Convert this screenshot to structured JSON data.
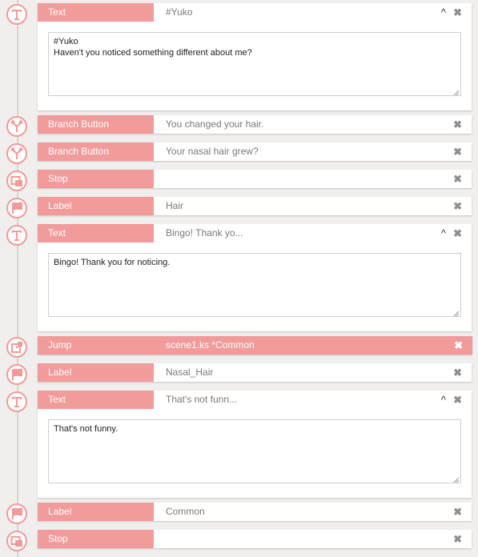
{
  "commands": [
    {
      "type": "Text",
      "summary": "#Yuko",
      "content": "#Yuko\nHaven't you noticed something different about me?",
      "expanded": true,
      "active": false,
      "icon": "text-icon"
    },
    {
      "type": "Branch Button",
      "summary": "You changed your hair.",
      "expanded": false,
      "active": false,
      "icon": "branch-icon"
    },
    {
      "type": "Branch Button",
      "summary": "Your nasal hair grew?",
      "expanded": false,
      "active": false,
      "icon": "branch-icon"
    },
    {
      "type": "Stop",
      "summary": "",
      "expanded": false,
      "active": false,
      "icon": "stop-icon"
    },
    {
      "type": "Label",
      "summary": "Hair",
      "expanded": false,
      "active": false,
      "icon": "flag-icon"
    },
    {
      "type": "Text",
      "summary": "Bingo! Thank yo...",
      "content": "Bingo! Thank you for noticing.",
      "expanded": true,
      "active": false,
      "icon": "text-icon"
    },
    {
      "type": "Jump",
      "summary": "scene1.ks *Common",
      "expanded": false,
      "active": true,
      "icon": "jump-icon"
    },
    {
      "type": "Label",
      "summary": "Nasal_Hair",
      "expanded": false,
      "active": false,
      "icon": "flag-icon"
    },
    {
      "type": "Text",
      "summary": "That's not funn...",
      "content": "That's not funny.",
      "expanded": true,
      "active": false,
      "icon": "text-icon"
    },
    {
      "type": "Label",
      "summary": "Common",
      "expanded": false,
      "active": false,
      "icon": "flag-icon"
    },
    {
      "type": "Stop",
      "summary": "",
      "expanded": false,
      "active": false,
      "icon": "stop-icon"
    }
  ],
  "controls": {
    "close_glyph": "✖",
    "collapse_glyph": "^"
  },
  "colors": {
    "accent": "#f29b9b",
    "node_border": "#f29a9a",
    "background": "#f1efee",
    "timeline": "#d9d4d2"
  }
}
